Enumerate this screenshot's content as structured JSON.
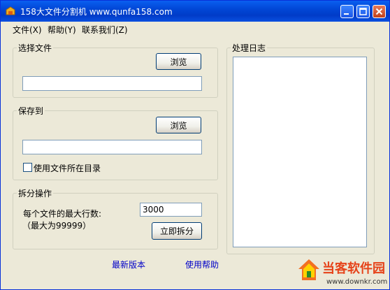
{
  "window": {
    "title": "158大文件分割机 www.qunfa158.com",
    "accent": "#0a5ff0"
  },
  "menu": {
    "items": [
      {
        "label": "文件(X)"
      },
      {
        "label": "帮助(Y)"
      },
      {
        "label": "联系我们(Z)"
      }
    ]
  },
  "select_file": {
    "title": "选择文件",
    "browse_label": "浏览",
    "path_value": ""
  },
  "save_to": {
    "title": "保存到",
    "browse_label": "浏览",
    "path_value": "",
    "use_source_dir_label": "使用文件所在目录",
    "use_source_dir_checked": false
  },
  "split": {
    "title": "拆分操作",
    "max_lines_label": "每个文件的最大行数:",
    "max_lines_value": "3000",
    "limit_note": "（最大为99999）",
    "split_now_label": "立即拆分"
  },
  "log": {
    "title": "处理日志"
  },
  "links": {
    "latest_version": "最新版本",
    "help": "使用帮助"
  },
  "watermark": {
    "text": "当客软件园",
    "url": "www.downkr.com"
  }
}
